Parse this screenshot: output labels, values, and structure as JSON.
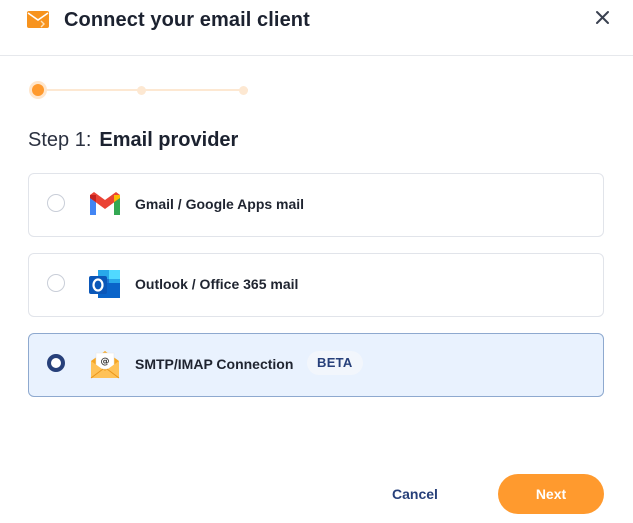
{
  "header": {
    "title": "Connect your email client",
    "icon": "orange-envelope-icon",
    "close_icon": "close-icon"
  },
  "stepper": {
    "total_steps": 3,
    "current_step": 1
  },
  "step": {
    "label": "Step 1:",
    "title": "Email provider"
  },
  "providers": [
    {
      "label": "Gmail / Google Apps mail",
      "icon": "gmail-icon",
      "selected": false
    },
    {
      "label": "Outlook / Office 365 mail",
      "icon": "outlook-icon",
      "selected": false
    },
    {
      "label": "SMTP/IMAP Connection",
      "icon": "smtp-imap-envelope-icon",
      "selected": true,
      "badge": "BETA"
    }
  ],
  "footer": {
    "cancel_label": "Cancel",
    "next_label": "Next"
  },
  "colors": {
    "accent": "#ff9a2e",
    "primary_text": "#27407a",
    "selected_bg": "#e9f2fe"
  }
}
